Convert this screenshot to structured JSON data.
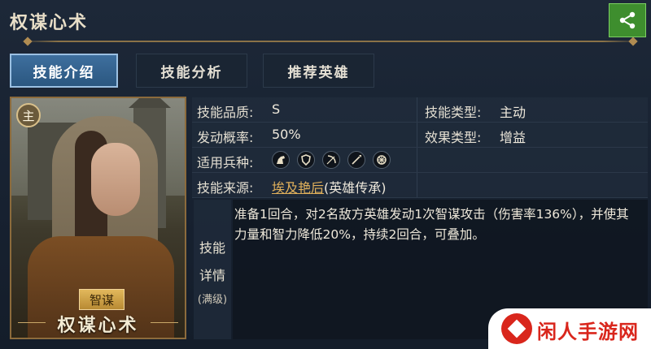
{
  "header": {
    "title": "权谋心术",
    "share_icon": "share-icon"
  },
  "tabs": [
    {
      "label": "技能介绍",
      "active": true
    },
    {
      "label": "技能分析",
      "active": false
    },
    {
      "label": "推荐英雄",
      "active": false
    }
  ],
  "card": {
    "badge": "主",
    "type_tag": "智谋",
    "name": "权谋心术"
  },
  "info": {
    "quality_label": "技能品质:",
    "quality_value": "S",
    "skill_type_label": "技能类型:",
    "skill_type_value": "主动",
    "chance_label": "发动概率:",
    "chance_value": "50%",
    "effect_type_label": "效果类型:",
    "effect_type_value": "增益",
    "troops_label": "适用兵种:",
    "troop_icons": [
      "cavalry-icon",
      "shield-icon",
      "bow-icon",
      "spear-icon",
      "wheel-icon"
    ],
    "source_label": "技能来源:",
    "source_link": "埃及艳后",
    "source_suffix": "(英雄传承)"
  },
  "detail": {
    "side_line1": "技能",
    "side_line2": "详情",
    "side_line3": "(满级)",
    "text": "准备1回合，对2名敌方英雄发动1次智谋攻击（伤害率136%），并使其力量和智力降低20%，持续2回合，可叠加。"
  },
  "watermark": {
    "text": "闲人手游网"
  },
  "colors": {
    "accent_tab": "#2b5780",
    "link": "#e0b05b",
    "share_bg": "#3e8e2e",
    "watermark_red": "#d9261c"
  }
}
